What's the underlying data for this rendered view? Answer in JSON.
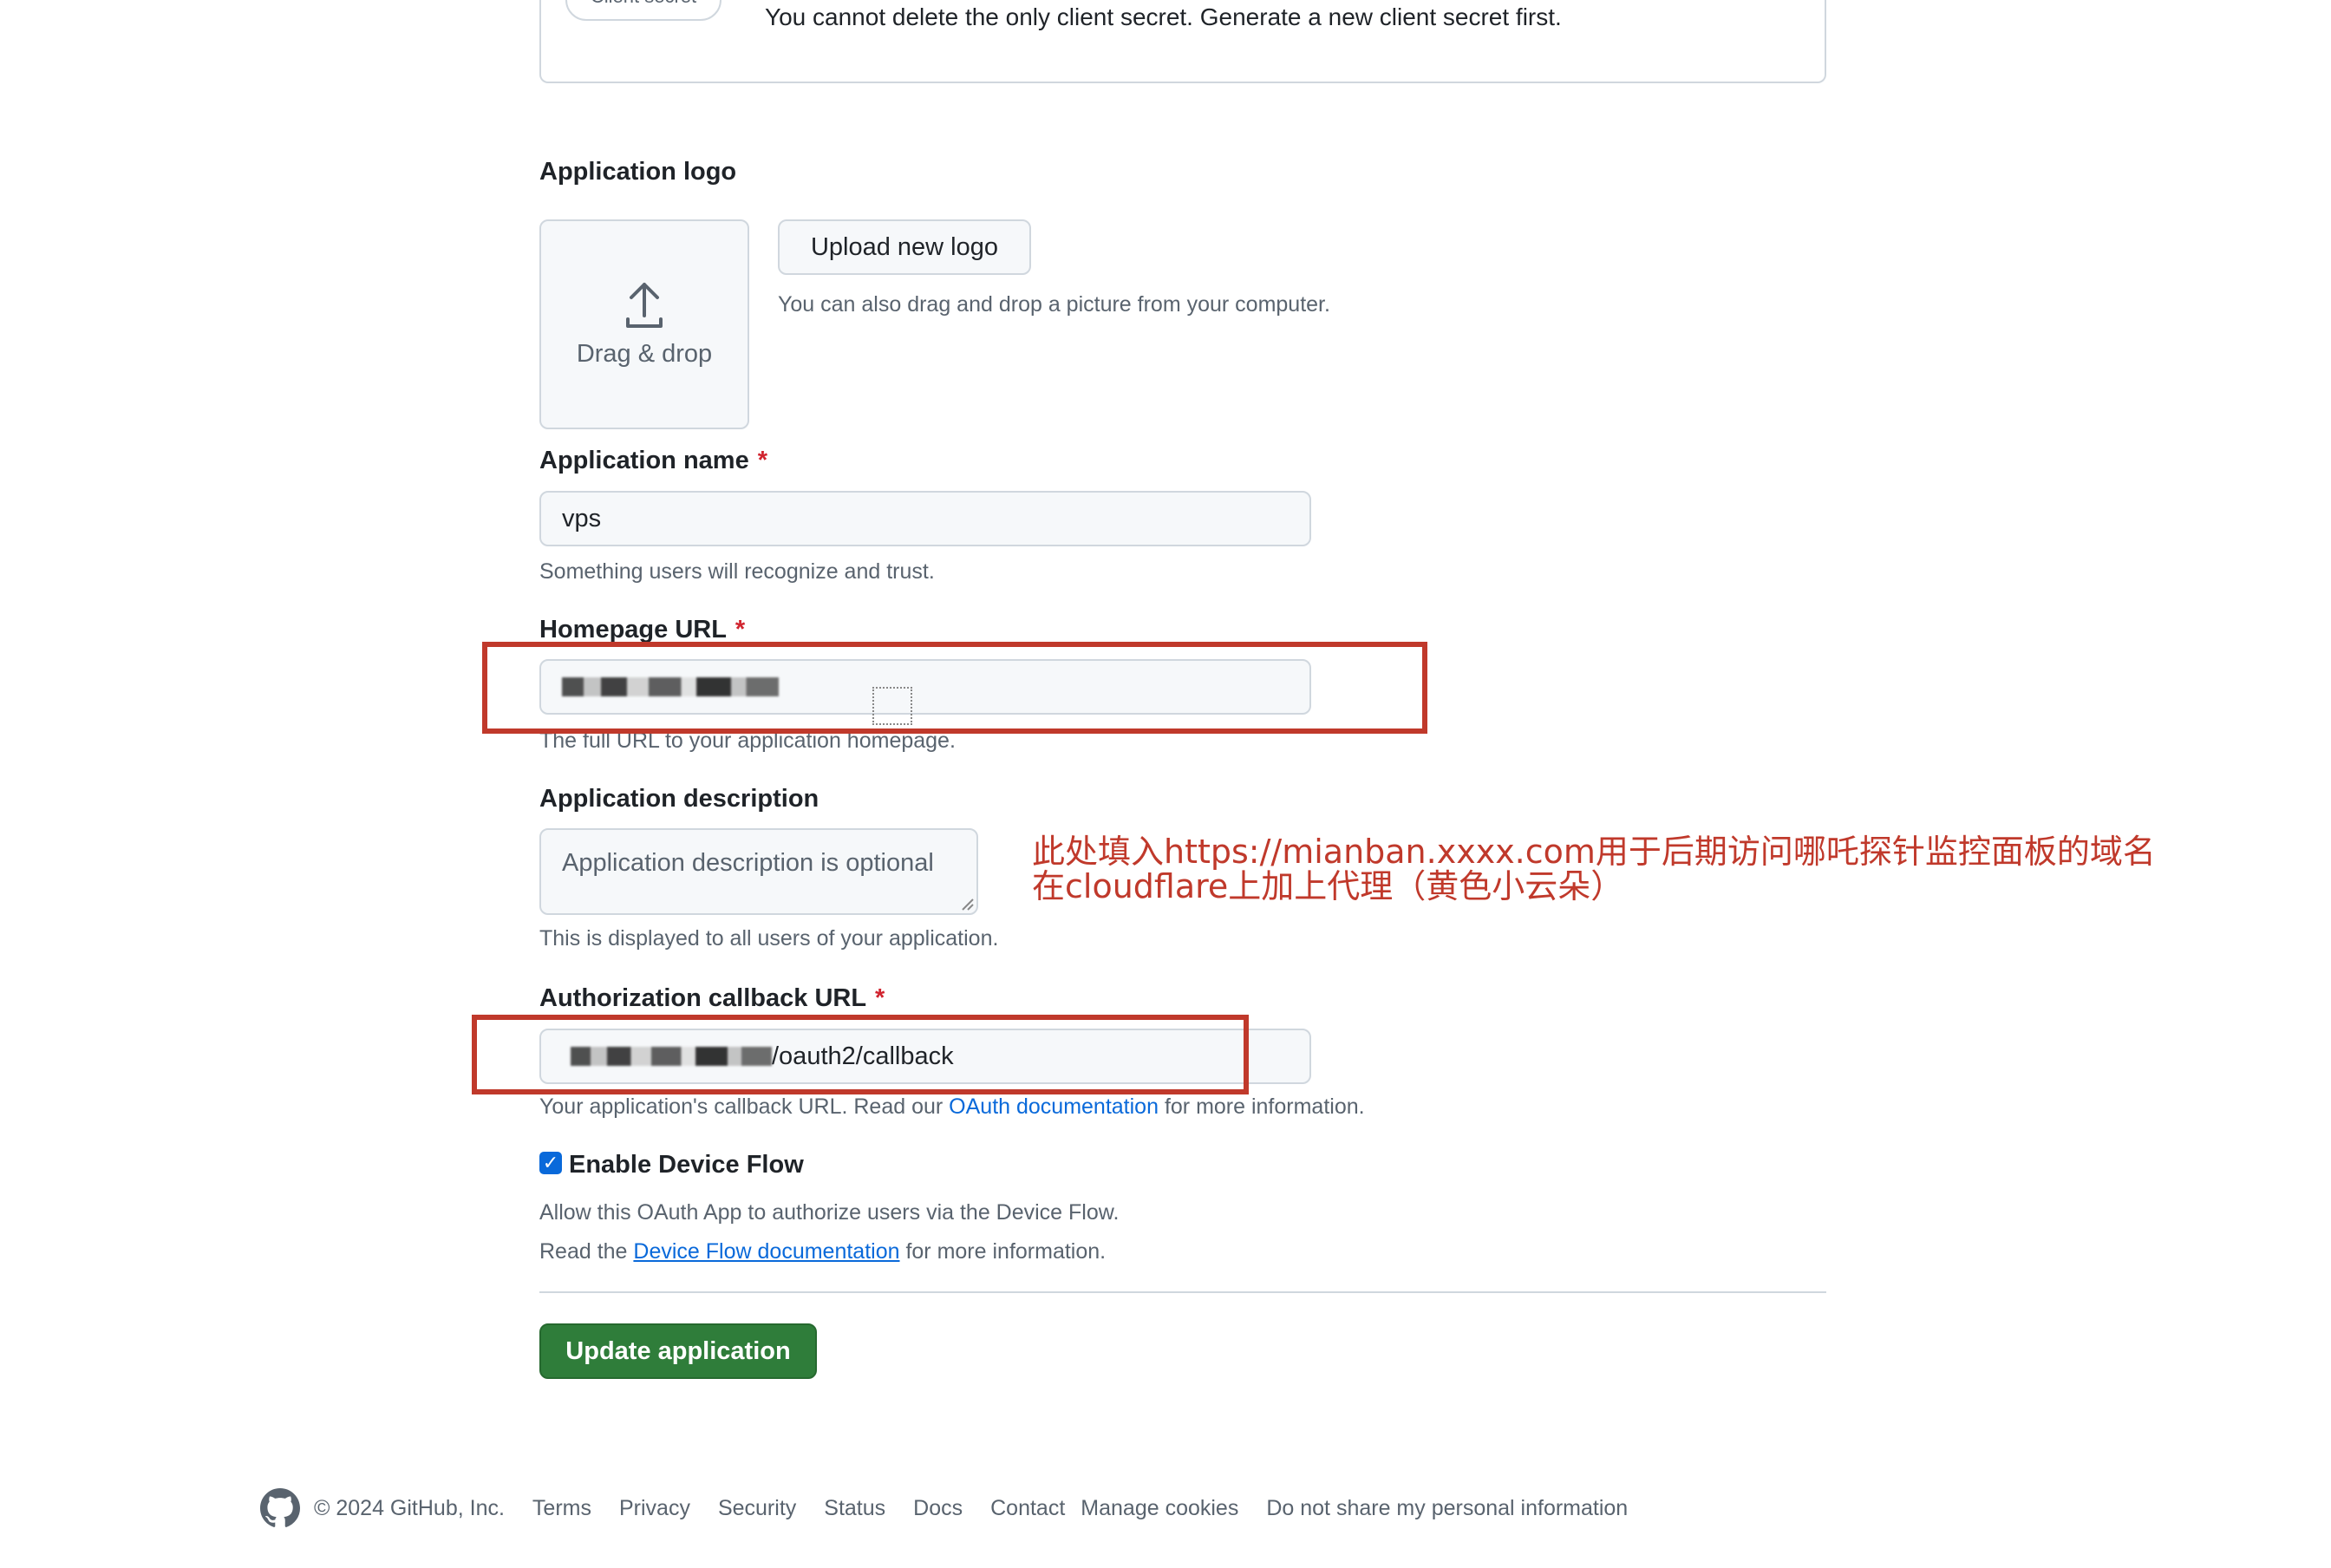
{
  "secret": {
    "pill_label": "Client secret",
    "note": "You cannot delete the only client secret. Generate a new client secret first."
  },
  "logo": {
    "heading": "Application logo",
    "drop_label": "Drag & drop",
    "upload_button": "Upload new logo",
    "hint": "You can also drag and drop a picture from your computer."
  },
  "app_name": {
    "label": "Application name",
    "required": "*",
    "value": "vps",
    "hint": "Something users will recognize and trust."
  },
  "homepage": {
    "label": "Homepage URL",
    "required": "*",
    "hint": "The full URL to your application homepage."
  },
  "description": {
    "label": "Application description",
    "placeholder": "Application description is optional",
    "hint": "This is displayed to all users of your application."
  },
  "annotation": {
    "line1": "此处填入https://mianban.xxxx.com用于后期访问哪吒探针监控面板的域名",
    "line2": "在cloudflare上加上代理（黄色小云朵）"
  },
  "callback": {
    "label": "Authorization callback URL",
    "required": "*",
    "value_suffix": "/oauth2/callback",
    "hint_before": "Your application's callback URL. Read our ",
    "hint_link": "OAuth documentation",
    "hint_after": " for more information."
  },
  "device_flow": {
    "label": "Enable Device Flow",
    "checked": true,
    "hint1": "Allow this OAuth App to authorize users via the Device Flow.",
    "hint2_before": "Read the ",
    "hint2_link": "Device Flow documentation",
    "hint2_after": " for more information."
  },
  "update_button": "Update application",
  "footer": {
    "copyright": "© 2024 GitHub, Inc.",
    "links": [
      "Terms",
      "Privacy",
      "Security",
      "Status",
      "Docs",
      "Contact",
      "Manage cookies",
      "Do not share my personal information"
    ]
  },
  "colors": {
    "primary_button": "#2f7d3a",
    "link": "#0969da",
    "annotation": "#c0392b",
    "required": "#d1242f"
  }
}
